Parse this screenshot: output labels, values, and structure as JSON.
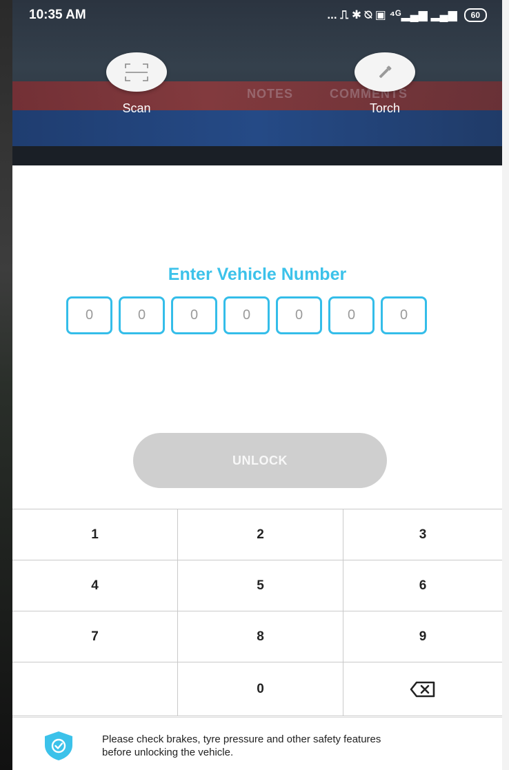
{
  "status_bar": {
    "time": "10:35 AM",
    "icons_text": "... ⎍ ✱ ⍉ ▣ ⁴ᴳ▂▄▆ ▂▄▆",
    "battery": "60"
  },
  "camera": {
    "scan_label": "Scan",
    "torch_label": "Torch",
    "bg_notes": "NOTES",
    "bg_comments": "COMMENTS"
  },
  "main": {
    "title": "Enter Vehicle Number",
    "digits": [
      "0",
      "0",
      "0",
      "0",
      "0",
      "0",
      "0"
    ],
    "unlock_label": "UNLOCK"
  },
  "keypad": {
    "keys": [
      "1",
      "2",
      "3",
      "4",
      "5",
      "6",
      "7",
      "8",
      "9",
      "",
      "0",
      "backspace"
    ]
  },
  "footer": {
    "line1": "Please check brakes, tyre pressure and other safety features",
    "line2": "before unlocking the vehicle."
  },
  "colors": {
    "accent": "#3cc2ea",
    "unlock_disabled": "#cfcfcf",
    "shield": "#3cc2ea"
  }
}
